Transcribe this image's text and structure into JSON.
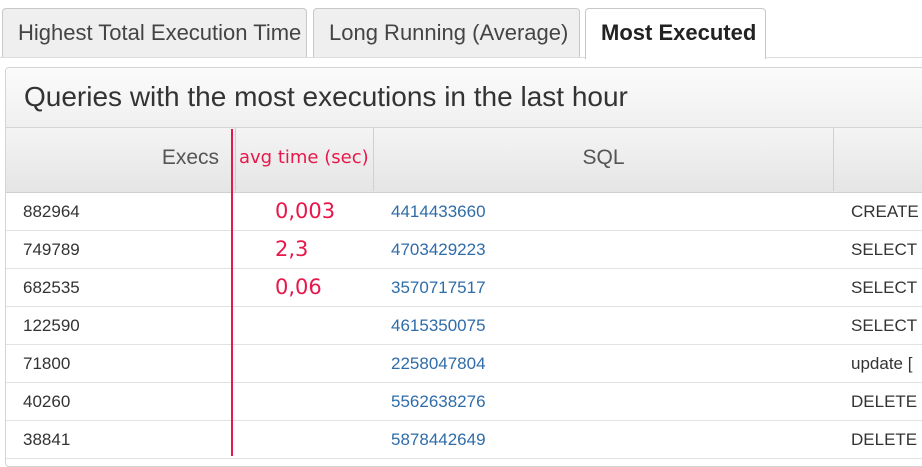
{
  "tabs": [
    {
      "label": "Highest Total Execution Time",
      "active": false
    },
    {
      "label": "Long Running (Average)",
      "active": false
    },
    {
      "label": "Most Executed",
      "active": true
    }
  ],
  "panel": {
    "title": "Queries with the most executions in the last hour"
  },
  "table": {
    "headers": {
      "execs": "Execs",
      "avg_time": "avg time (sec)",
      "sql": "SQL",
      "text": ""
    },
    "rows": [
      {
        "execs": "882964",
        "avg": "0,003",
        "sql": "4414433660",
        "text": "CREATE"
      },
      {
        "execs": "749789",
        "avg": "2,3",
        "sql": "4703429223",
        "text": "SELECT"
      },
      {
        "execs": "682535",
        "avg": "0,06",
        "sql": "3570717517",
        "text": "SELECT"
      },
      {
        "execs": "122590",
        "avg": "",
        "sql": "4615350075",
        "text": "SELECT"
      },
      {
        "execs": "71800",
        "avg": "",
        "sql": "2258047804",
        "text": "update ["
      },
      {
        "execs": "40260",
        "avg": "",
        "sql": "5562638276",
        "text": "DELETE"
      },
      {
        "execs": "38841",
        "avg": "",
        "sql": "5878442649",
        "text": "DELETE"
      }
    ]
  },
  "colors": {
    "annotation_red": "#e8174a",
    "link_blue": "#2f6ca8"
  }
}
